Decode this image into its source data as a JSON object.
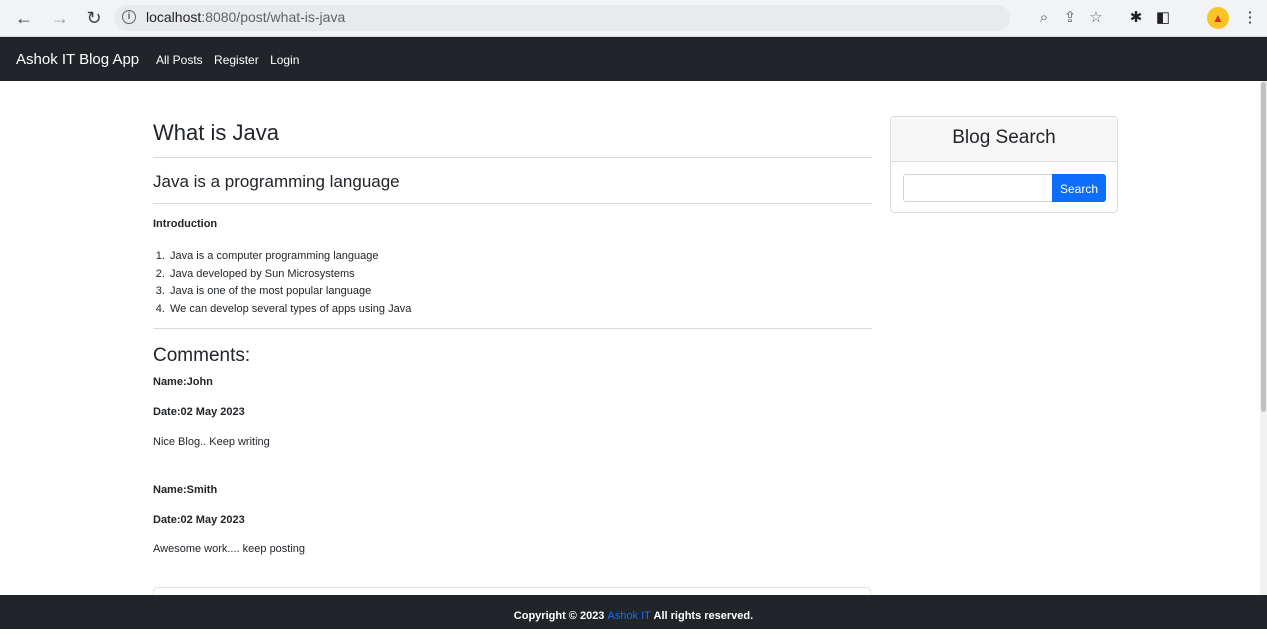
{
  "browser": {
    "url_host": "localhost",
    "url_rest": ":8080/post/what-is-java"
  },
  "navbar": {
    "brand": "Ashok IT Blog App",
    "links": [
      "All Posts",
      "Register",
      "Login"
    ]
  },
  "post": {
    "title": "What is Java",
    "subtitle": "Java is a programming language",
    "intro_heading": "Introduction",
    "points": [
      "Java is a computer programming language",
      "Java developed by Sun Microsystems",
      "Java is one of the most popular language",
      "We can develop several types of apps using Java"
    ]
  },
  "comments": {
    "heading": "Comments:",
    "items": [
      {
        "name": "Name:John",
        "date": "Date:02 May 2023",
        "text": "Nice Blog.. Keep writing"
      },
      {
        "name": "Name:Smith",
        "date": "Date:02 May 2023",
        "text": "Awesome work.... keep posting"
      }
    ]
  },
  "sidebar": {
    "card_title": "Blog Search",
    "search_placeholder": "",
    "search_button": "Search"
  },
  "footer": {
    "prefix": "Copyright © 2023 ",
    "link": "Ashok IT",
    "suffix": " All rights reserved."
  },
  "colors": {
    "navbar_bg": "#212529",
    "primary": "#0d6efd"
  }
}
